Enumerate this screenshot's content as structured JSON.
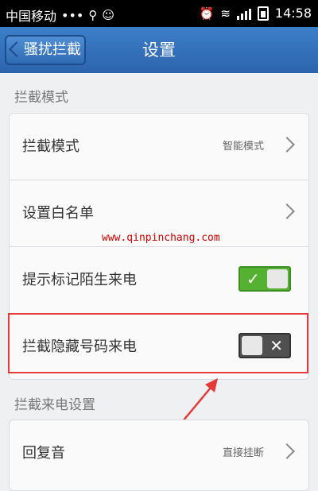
{
  "status_bar": {
    "carrier": "中国移动",
    "dots": "•••",
    "time": "14:58"
  },
  "title_bar": {
    "back_label": "骚扰拦截",
    "title": "设置"
  },
  "sections": [
    {
      "header": "拦截模式"
    },
    {
      "header": "拦截来电设置"
    }
  ],
  "settings": {
    "intercept_mode": {
      "label": "拦截模式",
      "value": "智能模式"
    },
    "whitelist": {
      "label": "设置白名单"
    },
    "mark_stranger": {
      "label": "提示标记陌生来电",
      "enabled": true
    },
    "block_hidden": {
      "label": "拦截隐藏号码来电",
      "enabled": false
    },
    "reply_tone": {
      "label": "回复音",
      "value": "直接挂断"
    }
  },
  "watermark": "www.qinpinchang.com",
  "annotation": {
    "color": "#e53a3a"
  },
  "icons": [
    "usb-icon",
    "android-icon",
    "alarm-icon",
    "wifi-icon",
    "signal-icon",
    "battery-icon",
    "back-arrow-icon",
    "chevron-right-icon",
    "check-icon",
    "close-icon"
  ]
}
